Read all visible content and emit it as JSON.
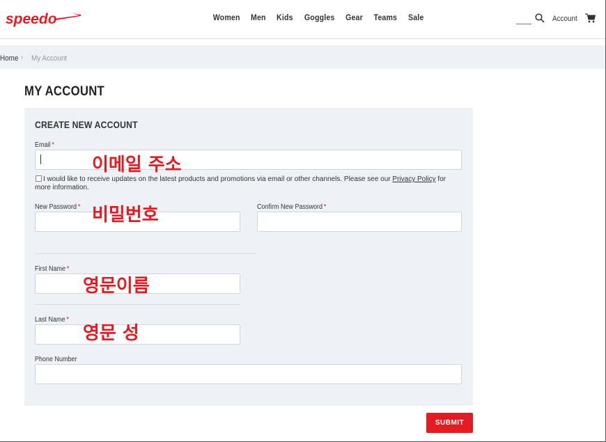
{
  "header": {
    "logo_text": "speedo",
    "nav": [
      "Women",
      "Men",
      "Kids",
      "Goggles",
      "Gear",
      "Teams",
      "Sale"
    ],
    "search_icon": "search-icon",
    "account_label": "Account",
    "cart_icon": "cart-icon",
    "brand_color": "#e31c23"
  },
  "breadcrumb": {
    "home": "Home",
    "separator": "›",
    "current": "My Account"
  },
  "page_title": "MY ACCOUNT",
  "form": {
    "section_title": "CREATE NEW ACCOUNT",
    "email": {
      "label": "Email",
      "value": ""
    },
    "consent": {
      "text_before": "I would like to receive updates on the latest products and promotions via email or other channels. Please see our ",
      "link": "Privacy Policy",
      "text_after": " for more information.",
      "checked": false
    },
    "new_password": {
      "label": "New Password",
      "value": ""
    },
    "confirm_password": {
      "label": "Confirm New Password",
      "value": ""
    },
    "first_name": {
      "label": "First Name",
      "value": ""
    },
    "last_name": {
      "label": "Last Name",
      "value": ""
    },
    "phone": {
      "label": "Phone Number",
      "value": ""
    },
    "required_mark": "*",
    "submit_label": "SUBMIT"
  },
  "annotations": {
    "email": "이메일 주소",
    "password": "비밀번호",
    "first_name": "영문이름",
    "last_name": "영문 성"
  }
}
